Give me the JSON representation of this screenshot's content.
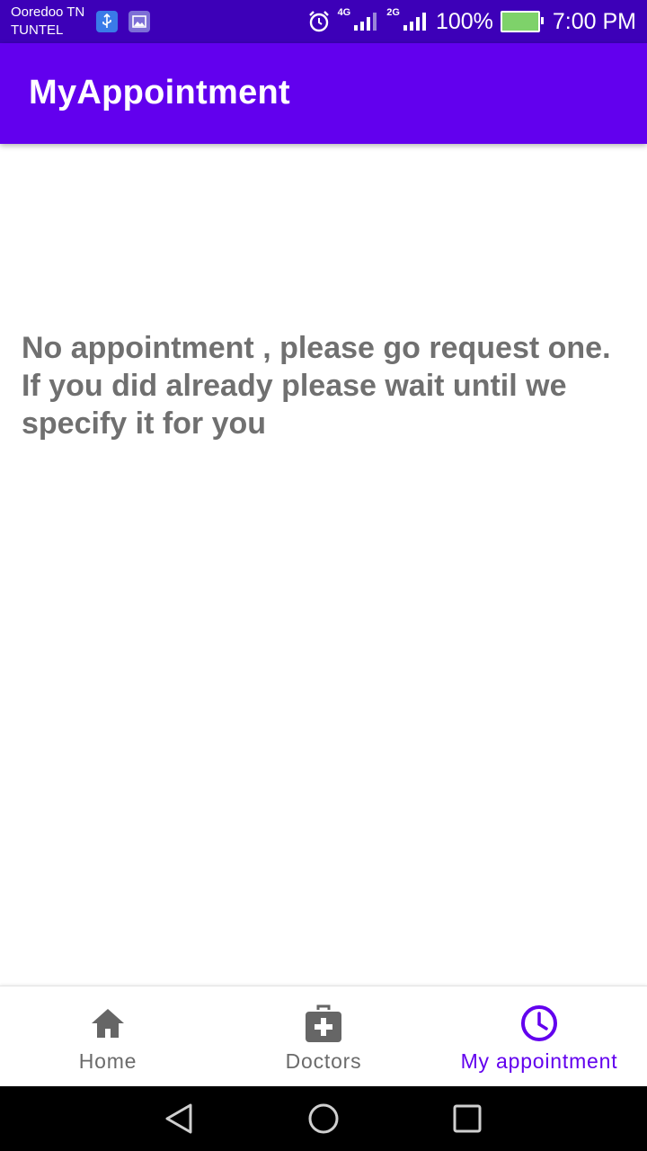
{
  "status_bar": {
    "carrier_line1": "Ooredoo TN",
    "carrier_line2": "TUNTEL",
    "network1": "4G",
    "network2": "2G",
    "battery": "100%",
    "time": "7:00 PM"
  },
  "app_bar": {
    "title": "MyAppointment"
  },
  "main": {
    "message": "No appointment , please go request one.\n If you did already please wait until we\nspecify it for you"
  },
  "bottom_nav": {
    "items": [
      {
        "label": "Home",
        "icon": "home-icon"
      },
      {
        "label": "Doctors",
        "icon": "medical-kit-icon"
      },
      {
        "label": "My appointment",
        "icon": "clock-icon"
      }
    ],
    "active_index": 2,
    "active_color": "#6200ee",
    "inactive_color": "#6b6b6b"
  },
  "colors": {
    "status_bar": "#3d00b8",
    "app_bar": "#6200ee",
    "message_text": "#707070"
  }
}
